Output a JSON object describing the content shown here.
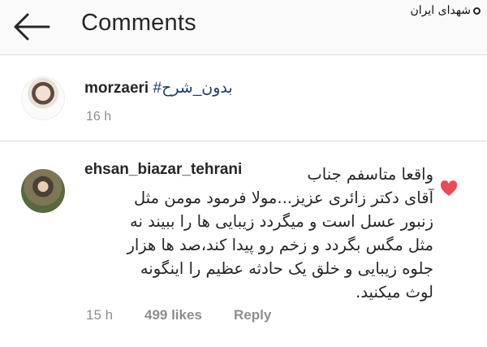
{
  "header": {
    "title": "Comments",
    "back_icon": "back-arrow-icon",
    "watermark": "شهدای ایران"
  },
  "caption": {
    "username": "morzaeri",
    "text": "#بدون_شرح",
    "time": "16 h"
  },
  "comment": {
    "username": "ehsan_biazar_tehrani",
    "lines": [
      "واقعا متاسفم جناب",
      "آقای دکتر زائری عزیز...مولا فرمود مومن مثل",
      "زنبور عسل است و میگردد زیبایی ها را ببیند نه",
      "مثل مگس بگردد و زخم رو پیدا کند،صد ها هزار",
      "جلوه زیبایی و خلق یک حادثه عظیم را اینگونه",
      "لوث میکنید."
    ],
    "time": "15 h",
    "likes": "499 likes",
    "reply": "Reply",
    "like_icon": "heart-icon",
    "like_color": "#ed4956"
  }
}
